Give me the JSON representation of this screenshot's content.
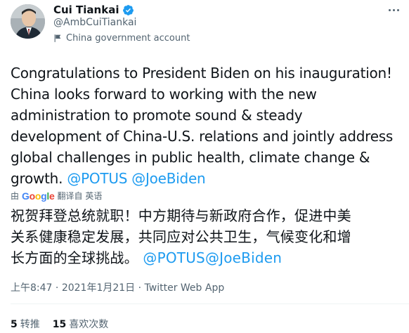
{
  "author": {
    "name": "Cui Tiankai",
    "handle": "@AmbCuiTiankai",
    "label": "China government account",
    "verified": true,
    "avatar_icon": "person-avatar"
  },
  "tweet": {
    "text_en": "Congratulations to President Biden on his inauguration!\nChina looks forward to working with the new\nadministration to promote sound & steady\ndevelopment of China-U.S. relations and jointly address\nglobal challenges in public health, climate change &\ngrowth. ",
    "mentions_en": [
      "@POTUS",
      "@JoeBiden"
    ],
    "translate_prefix": "由",
    "translate_service": "Google",
    "translate_label": "翻译自 英语",
    "text_zh": "祝贺拜登总统就职！中方期待与新政府合作，促进中美\n关系健康稳定发展，共同应对公共卫生，气候变化和增\n长方面的全球挑战。",
    "mentions_zh": [
      "@POTUS",
      "@JoeBiden"
    ]
  },
  "meta": {
    "time": "上午8:47",
    "date": "2021年1月21日",
    "source": "Twitter Web App",
    "separator": " · "
  },
  "stats": {
    "retweets_count": "5",
    "retweets_label": "转推",
    "likes_count": "15",
    "likes_label": "喜欢次数"
  },
  "colors": {
    "accent": "#1d9bf0",
    "text": "#0f1419",
    "muted": "#536471"
  }
}
